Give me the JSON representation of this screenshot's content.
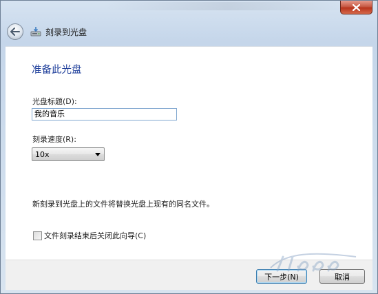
{
  "window": {
    "close_icon": "close-icon"
  },
  "nav": {
    "back_icon": "back-arrow-icon",
    "app_icon": "disc-burner-icon",
    "title": "刻录到光盘"
  },
  "content": {
    "heading": "准备此光盘",
    "disc_title_label": "光盘标题(D):",
    "disc_title_value": "我的音乐",
    "burn_speed_label": "刻录速度(R):",
    "burn_speed_value": "10x",
    "notice": "新刻录到光盘上的文件将替换光盘上现有的同名文件。",
    "close_wizard_checkbox": {
      "label": "文件刻录结束后关闭此向导(C)",
      "checked": false
    }
  },
  "footer": {
    "next_label": "下一步(N)",
    "cancel_label": "取消"
  },
  "colors": {
    "heading": "#1f3f9b",
    "frame": "#c5d6ea",
    "close_button": "#c75a45"
  }
}
